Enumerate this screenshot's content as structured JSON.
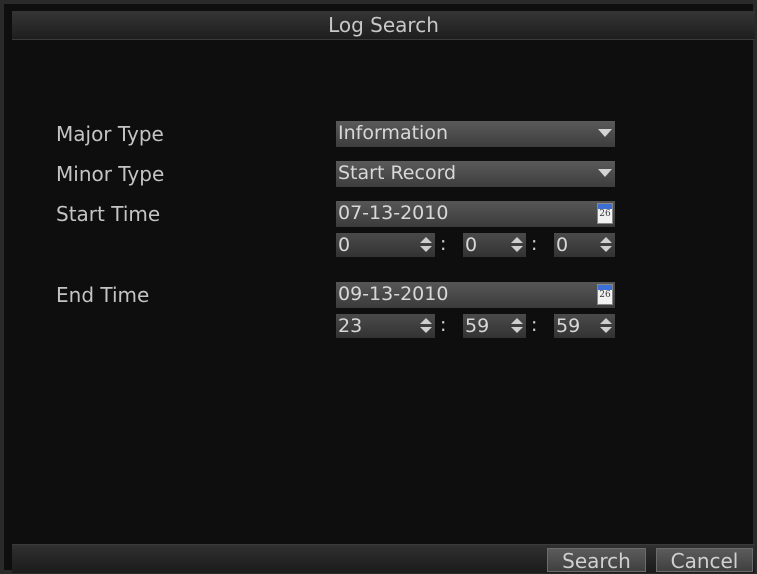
{
  "window": {
    "title": "Log Search"
  },
  "form": {
    "major_type": {
      "label": "Major Type",
      "value": "Information"
    },
    "minor_type": {
      "label": "Minor Type",
      "value": "Start Record"
    },
    "start_time": {
      "label": "Start Time",
      "date": "07-13-2010",
      "hour": "0",
      "minute": "0",
      "second": "0"
    },
    "end_time": {
      "label": "End Time",
      "date": "09-13-2010",
      "hour": "23",
      "minute": "59",
      "second": "59"
    },
    "calendar_icon_text": "26",
    "colon": ":"
  },
  "buttons": {
    "search": "Search",
    "cancel": "Cancel"
  }
}
